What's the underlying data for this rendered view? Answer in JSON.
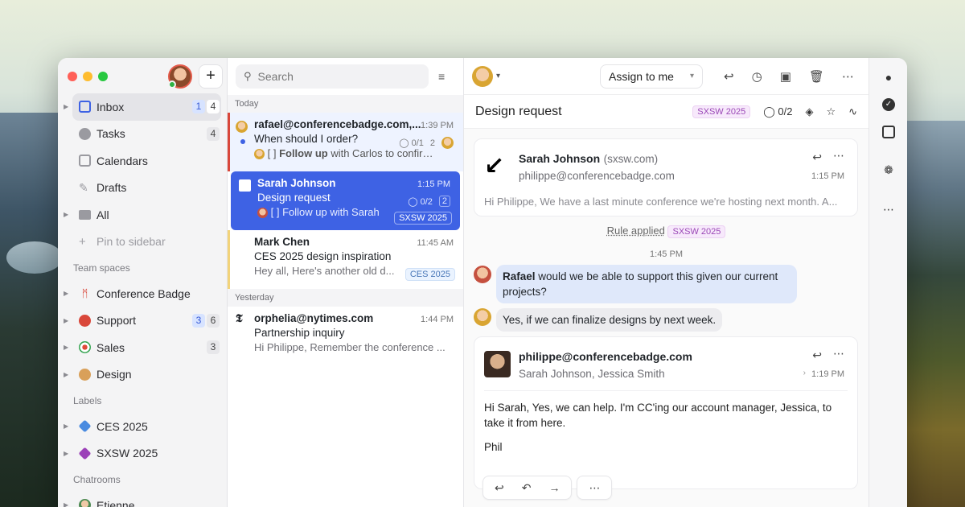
{
  "sidebar": {
    "items": [
      {
        "label": "Inbox",
        "badges": [
          "1",
          "4"
        ]
      },
      {
        "label": "Tasks",
        "badges": [
          "4"
        ]
      },
      {
        "label": "Calendars"
      },
      {
        "label": "Drafts"
      },
      {
        "label": "All"
      },
      {
        "label": "Pin to sidebar"
      }
    ],
    "team_spaces_label": "Team spaces",
    "teams": [
      {
        "label": "Conference Badge"
      },
      {
        "label": "Support",
        "badges": [
          "3",
          "6"
        ]
      },
      {
        "label": "Sales",
        "badges": [
          "3"
        ]
      },
      {
        "label": "Design"
      }
    ],
    "labels_label": "Labels",
    "labels": [
      {
        "label": "CES 2025",
        "color": "#4a8be0"
      },
      {
        "label": "SXSW 2025",
        "color": "#9b40b8"
      }
    ],
    "chatrooms_label": "Chatrooms",
    "chatrooms": [
      {
        "label": "Etienne"
      }
    ]
  },
  "list": {
    "search_placeholder": "Search",
    "groups": [
      "Today",
      "Yesterday"
    ],
    "messages": [
      {
        "from": "rafael@conferencebadge.com,...",
        "time": "1:39 PM",
        "subject": "When should I order?",
        "preview_bold": "Follow up",
        "preview": "[ ]  with Carlos to confirm ...",
        "task": "0/1",
        "count": "2"
      },
      {
        "from": "Sarah Johnson",
        "time": "1:15 PM",
        "subject": "Design request",
        "preview": "[ ] Follow up with Sarah",
        "task": "0/2",
        "count": "2",
        "tag": "SXSW 2025"
      },
      {
        "from": "Mark Chen",
        "time": "11:45 AM",
        "subject": "CES 2025 design inspiration",
        "preview": "Hey all, Here's another old d...",
        "tag": "CES 2025"
      },
      {
        "from": "orphelia@nytimes.com",
        "time": "1:44 PM",
        "subject": "Partnership inquiry",
        "preview": "Hi Philippe, Remember the conference ..."
      }
    ]
  },
  "detail": {
    "assign_label": "Assign to me",
    "title": "Design request",
    "tag": "SXSW 2025",
    "task_count": "0/2",
    "email1": {
      "from_name": "Sarah Johnson",
      "from_domain": "(sxsw.com)",
      "to": "philippe@conferencebadge.com",
      "time": "1:15 PM",
      "preview": "Hi Philippe, We have a last minute conference we're hosting next month. A..."
    },
    "rule_text": "Rule applied",
    "rule_tag": "SXSW 2025",
    "chat_time": "1:45 PM",
    "chat1_name": "Rafael",
    "chat1_text": " would we be able to support this given our current projects?",
    "chat2_text": "Yes, if we can finalize designs by next week.",
    "email2": {
      "from": "philippe@conferencebadge.com",
      "to": "Sarah Johnson, Jessica Smith",
      "time": "1:19 PM",
      "body1": "Hi Sarah, Yes, we can help. I'm CC'ing our account manager, Jessica, to take it from here.",
      "body2": "Phil"
    }
  },
  "colors": {
    "accent": "#3e62e4",
    "sxsw_tag": "#9a47b6",
    "ces_tag": "#4b78b8"
  }
}
